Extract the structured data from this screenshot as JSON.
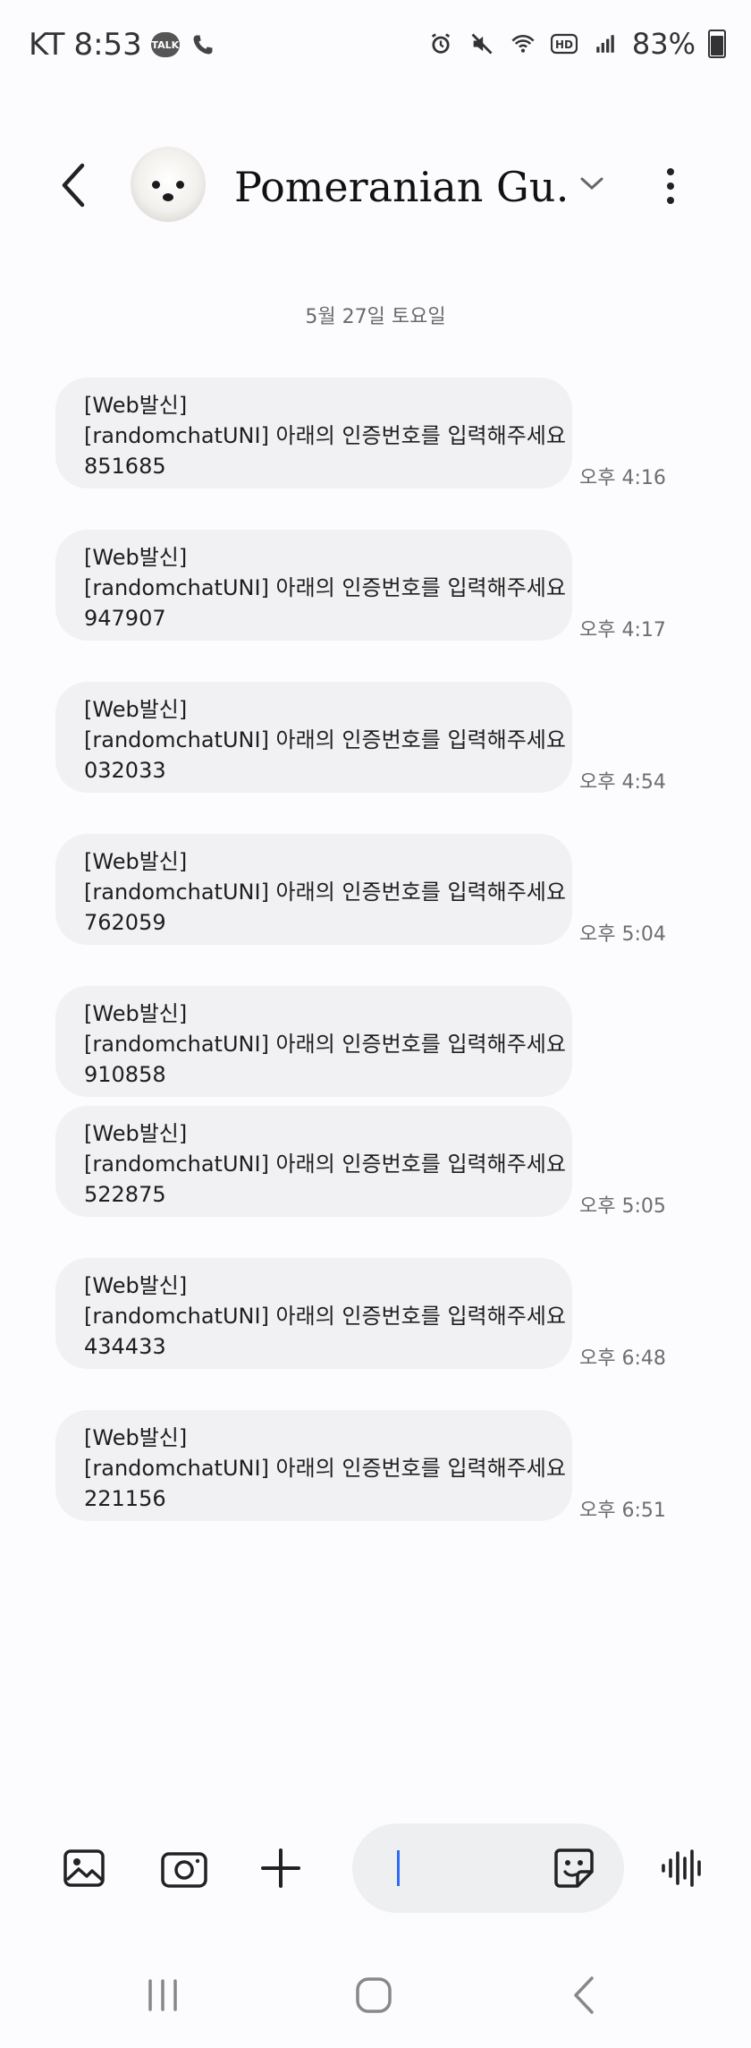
{
  "status_bar": {
    "carrier": "KT",
    "time": "8:53",
    "talk_badge": "TALK",
    "battery": "83%"
  },
  "header": {
    "contact_name": "Pomeranian Gu…"
  },
  "date_separator": "5월 27일 토요일",
  "messages": [
    {
      "line1": "[Web발신]",
      "line2": "[randomchatUNI] 아래의 인증번호를 입력해주세요",
      "code": "851685",
      "time": "오후 4:16"
    },
    {
      "line1": "[Web발신]",
      "line2": "[randomchatUNI] 아래의 인증번호를 입력해주세요",
      "code": "947907",
      "time": "오후 4:17"
    },
    {
      "line1": "[Web발신]",
      "line2": "[randomchatUNI] 아래의 인증번호를 입력해주세요",
      "code": "032033",
      "time": "오후 4:54"
    },
    {
      "line1": "[Web발신]",
      "line2": "[randomchatUNI] 아래의 인증번호를 입력해주세요",
      "code": "762059",
      "time": "오후 5:04"
    },
    {
      "line1": "[Web발신]",
      "line2": "[randomchatUNI] 아래의 인증번호를 입력해주세요",
      "code": "910858",
      "time": ""
    },
    {
      "line1": "[Web발신]",
      "line2": "[randomchatUNI] 아래의 인증번호를 입력해주세요",
      "code": "522875",
      "time": "오후 5:05"
    },
    {
      "line1": "[Web발신]",
      "line2": "[randomchatUNI] 아래의 인증번호를 입력해주세요",
      "code": "434433",
      "time": "오후 6:48"
    },
    {
      "line1": "[Web발신]",
      "line2": "[randomchatUNI] 아래의 인증번호를 입력해주세요",
      "code": "221156",
      "time": "오후 6:51"
    }
  ],
  "composer": {
    "icons": [
      "gallery-icon",
      "camera-icon",
      "plus-icon",
      "sticker-icon",
      "voice-icon"
    ]
  },
  "colors": {
    "bubble": "#f1f1f3",
    "cursor": "#2e6cf6",
    "time_text": "#6e6e6e"
  }
}
